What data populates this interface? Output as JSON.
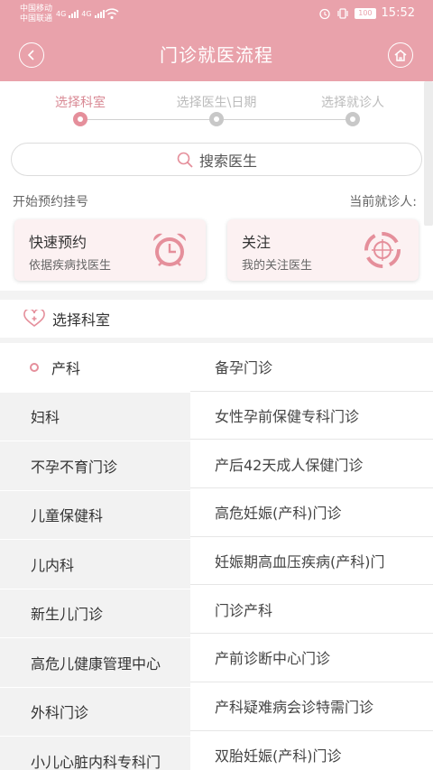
{
  "status_bar": {
    "carrier1": "中国移动",
    "carrier2": "中国联通",
    "net1": "4G",
    "net2": "4G",
    "battery": "100",
    "time": "15:52"
  },
  "header": {
    "title": "门诊就医流程",
    "back_icon": "chevron-left-icon",
    "home_icon": "home-icon",
    "color": "#e9a2ab"
  },
  "steps": [
    {
      "label": "选择科室",
      "active": true
    },
    {
      "label": "选择医生\\日期",
      "active": false
    },
    {
      "label": "选择就诊人",
      "active": false
    }
  ],
  "search": {
    "label": "搜索医生",
    "icon": "search-icon"
  },
  "booking": {
    "start_label": "开始预约挂号",
    "patient_label": "当前就诊人:",
    "cards": [
      {
        "title": "快速预约",
        "subtitle": "依据疾病找医生",
        "icon": "alarm-clock-icon"
      },
      {
        "title": "关注",
        "subtitle": "我的关注医生",
        "icon": "target-icon"
      }
    ]
  },
  "department_section": {
    "title": "选择科室",
    "icon": "medical-heart-icon"
  },
  "departments": [
    "产科",
    "妇科",
    "不孕不育门诊",
    "儿童保健科",
    "儿内科",
    "新生儿门诊",
    "高危儿健康管理中心",
    "外科门诊",
    "小儿心脏内科专科门"
  ],
  "selected_department": "产科",
  "clinics": [
    "备孕门诊",
    "女性孕前保健专科门诊",
    "产后42天成人保健门诊",
    "高危妊娠(产科)门诊",
    "妊娠期高血压疾病(产科)门",
    "门诊产科",
    "产前诊断中心门诊",
    "产科疑难病会诊特需门诊",
    "双胎妊娠(产科)门诊"
  ],
  "accent": "#e58f9b"
}
